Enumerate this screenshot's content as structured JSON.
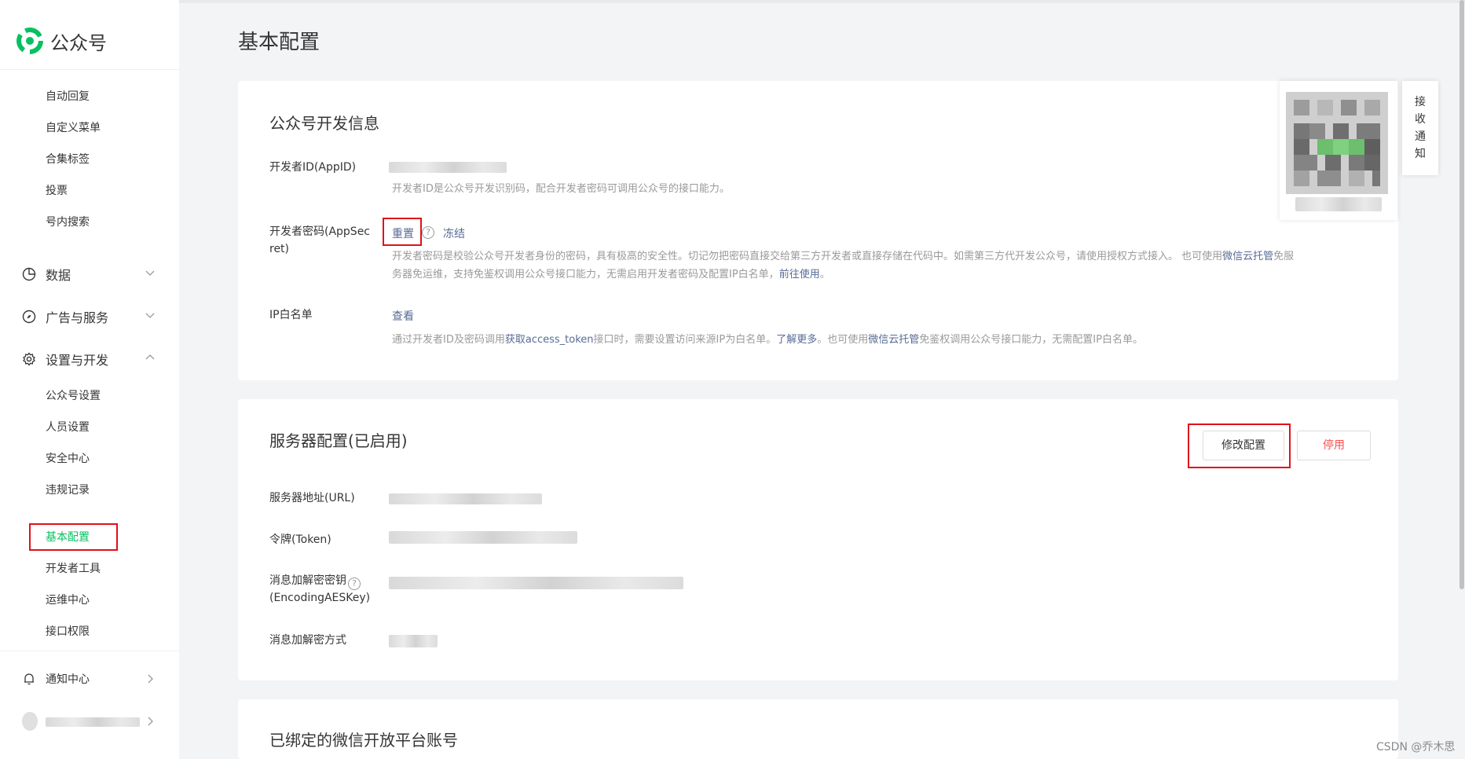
{
  "app": {
    "name": "公众号"
  },
  "sidebar": {
    "top_items": [
      "自动回复",
      "自定义菜单",
      "合集标签",
      "投票",
      "号内搜索"
    ],
    "groups": [
      {
        "label": "数据",
        "icon": "chart-pie-icon",
        "state": "collapsed"
      },
      {
        "label": "广告与服务",
        "icon": "compass-icon",
        "state": "collapsed"
      },
      {
        "label": "设置与开发",
        "icon": "gear-icon",
        "state": "expanded"
      }
    ],
    "settings_items": [
      "公众号设置",
      "人员设置",
      "安全中心",
      "违规记录"
    ],
    "dev_items": [
      "基本配置",
      "开发者工具",
      "运维中心",
      "接口权限"
    ],
    "active_item": "基本配置",
    "notify": {
      "label": "通知中心",
      "icon": "bell-icon"
    }
  },
  "page": {
    "title": "基本配置"
  },
  "dev_info": {
    "title": "公众号开发信息",
    "appid_label": "开发者ID(AppID)",
    "appid_desc": "开发者ID是公众号开发识别码，配合开发者密码可调用公众号的接口能力。",
    "secret_label_line1": "开发者密码(AppSec",
    "secret_label_line2": "ret)",
    "secret_reset": "重置",
    "secret_help": "?",
    "secret_freeze": "冻结",
    "secret_desc_1": "开发者密码是校验公众号开发者身份的密码，具有极高的安全性。切记勿把密码直接交给第三方开发者或直接存储在代码中。如需第三方代开发公众号，请使用授权方式接入。 也可使用",
    "secret_desc_link1": "微信云托管",
    "secret_desc_2": "免服",
    "secret_desc_3": "务器免运维，支持免鉴权调用公众号接口能力，无需启用开发者密码及配置IP白名单，",
    "secret_desc_link2": "前往使用",
    "secret_desc_4": "。",
    "ip_label": "IP白名单",
    "ip_view": "查看",
    "ip_desc_1": "通过开发者ID及密码调用",
    "ip_desc_link1": "获取access_token",
    "ip_desc_2": "接口时，需要设置访问来源IP为白名单。",
    "ip_desc_link2": "了解更多",
    "ip_desc_3": "。也可使用",
    "ip_desc_link3": "微信云托管",
    "ip_desc_4": "免鉴权调用公众号接口能力，无需配置IP白名单。"
  },
  "server_config": {
    "title": "服务器配置(已启用)",
    "modify_button": "修改配置",
    "disable_button": "停用",
    "url_label": "服务器地址(URL)",
    "token_label": "令牌(Token)",
    "aeskey_label_line1": "消息加解密密钥",
    "aeskey_help": "?",
    "aeskey_label_line2": "(EncodingAESKey)",
    "encrypt_label": "消息加解密方式"
  },
  "bound_platform": {
    "title": "已绑定的微信开放平台账号"
  },
  "float_panel": {
    "notify_chars": [
      "接",
      "收",
      "通",
      "知"
    ]
  },
  "watermark": "CSDN @乔木思",
  "colors": {
    "accent_green": "#07c160",
    "link_blue": "#576b95",
    "danger_red": "#fa5151",
    "highlight_box": "#e0101a"
  }
}
